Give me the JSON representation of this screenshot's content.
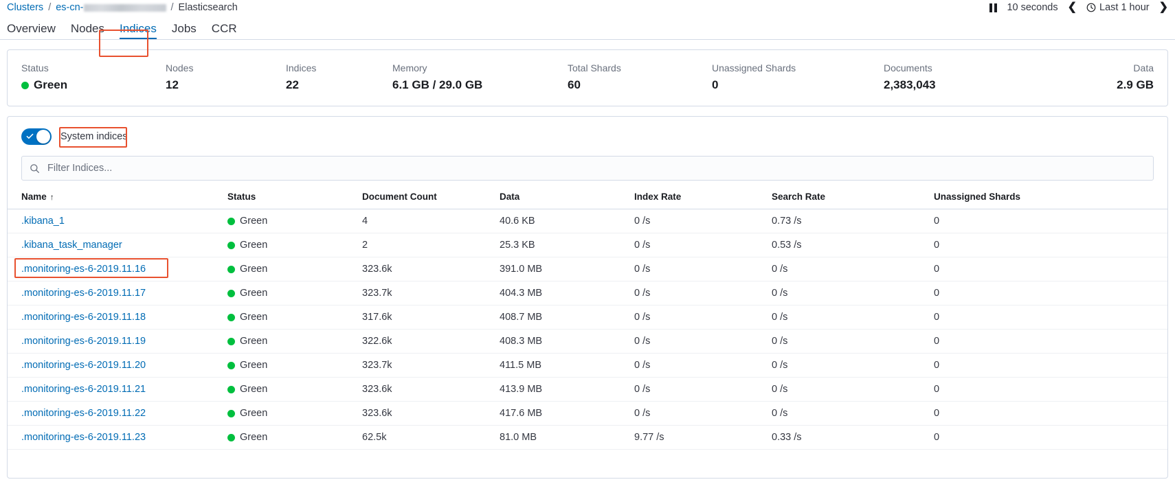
{
  "breadcrumb": {
    "clusters_label": "Clusters",
    "sep": "/",
    "cluster_prefix": "es-cn-",
    "current": "Elasticsearch"
  },
  "toolbar": {
    "pause_icon": "pause-icon",
    "refresh_interval": "10 seconds",
    "prev_icon": "chevron-left-icon",
    "next_icon": "chevron-right-icon",
    "clock_icon": "clock-icon",
    "time_range": "Last 1 hour"
  },
  "tabs": [
    {
      "label": "Overview",
      "active": false
    },
    {
      "label": "Nodes",
      "active": false
    },
    {
      "label": "Indices",
      "active": true
    },
    {
      "label": "Jobs",
      "active": false
    },
    {
      "label": "CCR",
      "active": false
    }
  ],
  "summary": [
    {
      "label": "Status",
      "value": "Green",
      "dot_color": "#00bf3e"
    },
    {
      "label": "Nodes",
      "value": "12"
    },
    {
      "label": "Indices",
      "value": "22"
    },
    {
      "label": "Memory",
      "value": "6.1 GB / 29.0 GB"
    },
    {
      "label": "Total Shards",
      "value": "60"
    },
    {
      "label": "Unassigned Shards",
      "value": "0"
    },
    {
      "label": "Documents",
      "value": "2,383,043"
    },
    {
      "label": "Data",
      "value": "2.9 GB"
    }
  ],
  "controls": {
    "system_indices_label": "System indices",
    "system_indices_on": true,
    "search_icon": "search-icon",
    "search_placeholder": "Filter Indices...",
    "search_value": ""
  },
  "table": {
    "columns": [
      "Name",
      "Status",
      "Document Count",
      "Data",
      "Index Rate",
      "Search Rate",
      "Unassigned Shards"
    ],
    "sort_column": "Name",
    "sort_direction_icon": "arrow-up-icon",
    "status_dot_color": "#00bf3e",
    "rows": [
      {
        "name": ".kibana_1",
        "status": "Green",
        "documents": "4",
        "data": "40.6 KB",
        "index_rate": "0 /s",
        "search_rate": "0.73 /s",
        "unassigned": "0"
      },
      {
        "name": ".kibana_task_manager",
        "status": "Green",
        "documents": "2",
        "data": "25.3 KB",
        "index_rate": "0 /s",
        "search_rate": "0.53 /s",
        "unassigned": "0"
      },
      {
        "name": ".monitoring-es-6-2019.11.16",
        "status": "Green",
        "documents": "323.6k",
        "data": "391.0 MB",
        "index_rate": "0 /s",
        "search_rate": "0 /s",
        "unassigned": "0"
      },
      {
        "name": ".monitoring-es-6-2019.11.17",
        "status": "Green",
        "documents": "323.7k",
        "data": "404.3 MB",
        "index_rate": "0 /s",
        "search_rate": "0 /s",
        "unassigned": "0"
      },
      {
        "name": ".monitoring-es-6-2019.11.18",
        "status": "Green",
        "documents": "317.6k",
        "data": "408.7 MB",
        "index_rate": "0 /s",
        "search_rate": "0 /s",
        "unassigned": "0"
      },
      {
        "name": ".monitoring-es-6-2019.11.19",
        "status": "Green",
        "documents": "322.6k",
        "data": "408.3 MB",
        "index_rate": "0 /s",
        "search_rate": "0 /s",
        "unassigned": "0"
      },
      {
        "name": ".monitoring-es-6-2019.11.20",
        "status": "Green",
        "documents": "323.7k",
        "data": "411.5 MB",
        "index_rate": "0 /s",
        "search_rate": "0 /s",
        "unassigned": "0"
      },
      {
        "name": ".monitoring-es-6-2019.11.21",
        "status": "Green",
        "documents": "323.6k",
        "data": "413.9 MB",
        "index_rate": "0 /s",
        "search_rate": "0 /s",
        "unassigned": "0"
      },
      {
        "name": ".monitoring-es-6-2019.11.22",
        "status": "Green",
        "documents": "323.6k",
        "data": "417.6 MB",
        "index_rate": "0 /s",
        "search_rate": "0 /s",
        "unassigned": "0"
      },
      {
        "name": ".monitoring-es-6-2019.11.23",
        "status": "Green",
        "documents": "62.5k",
        "data": "81.0 MB",
        "index_rate": "9.77 /s",
        "search_rate": "0.33 /s",
        "unassigned": "0"
      }
    ]
  },
  "annotations": {
    "color": "#e8502e",
    "targets": [
      "Indices",
      "System indices",
      ".monitoring-es-6-2019.11.16"
    ]
  }
}
